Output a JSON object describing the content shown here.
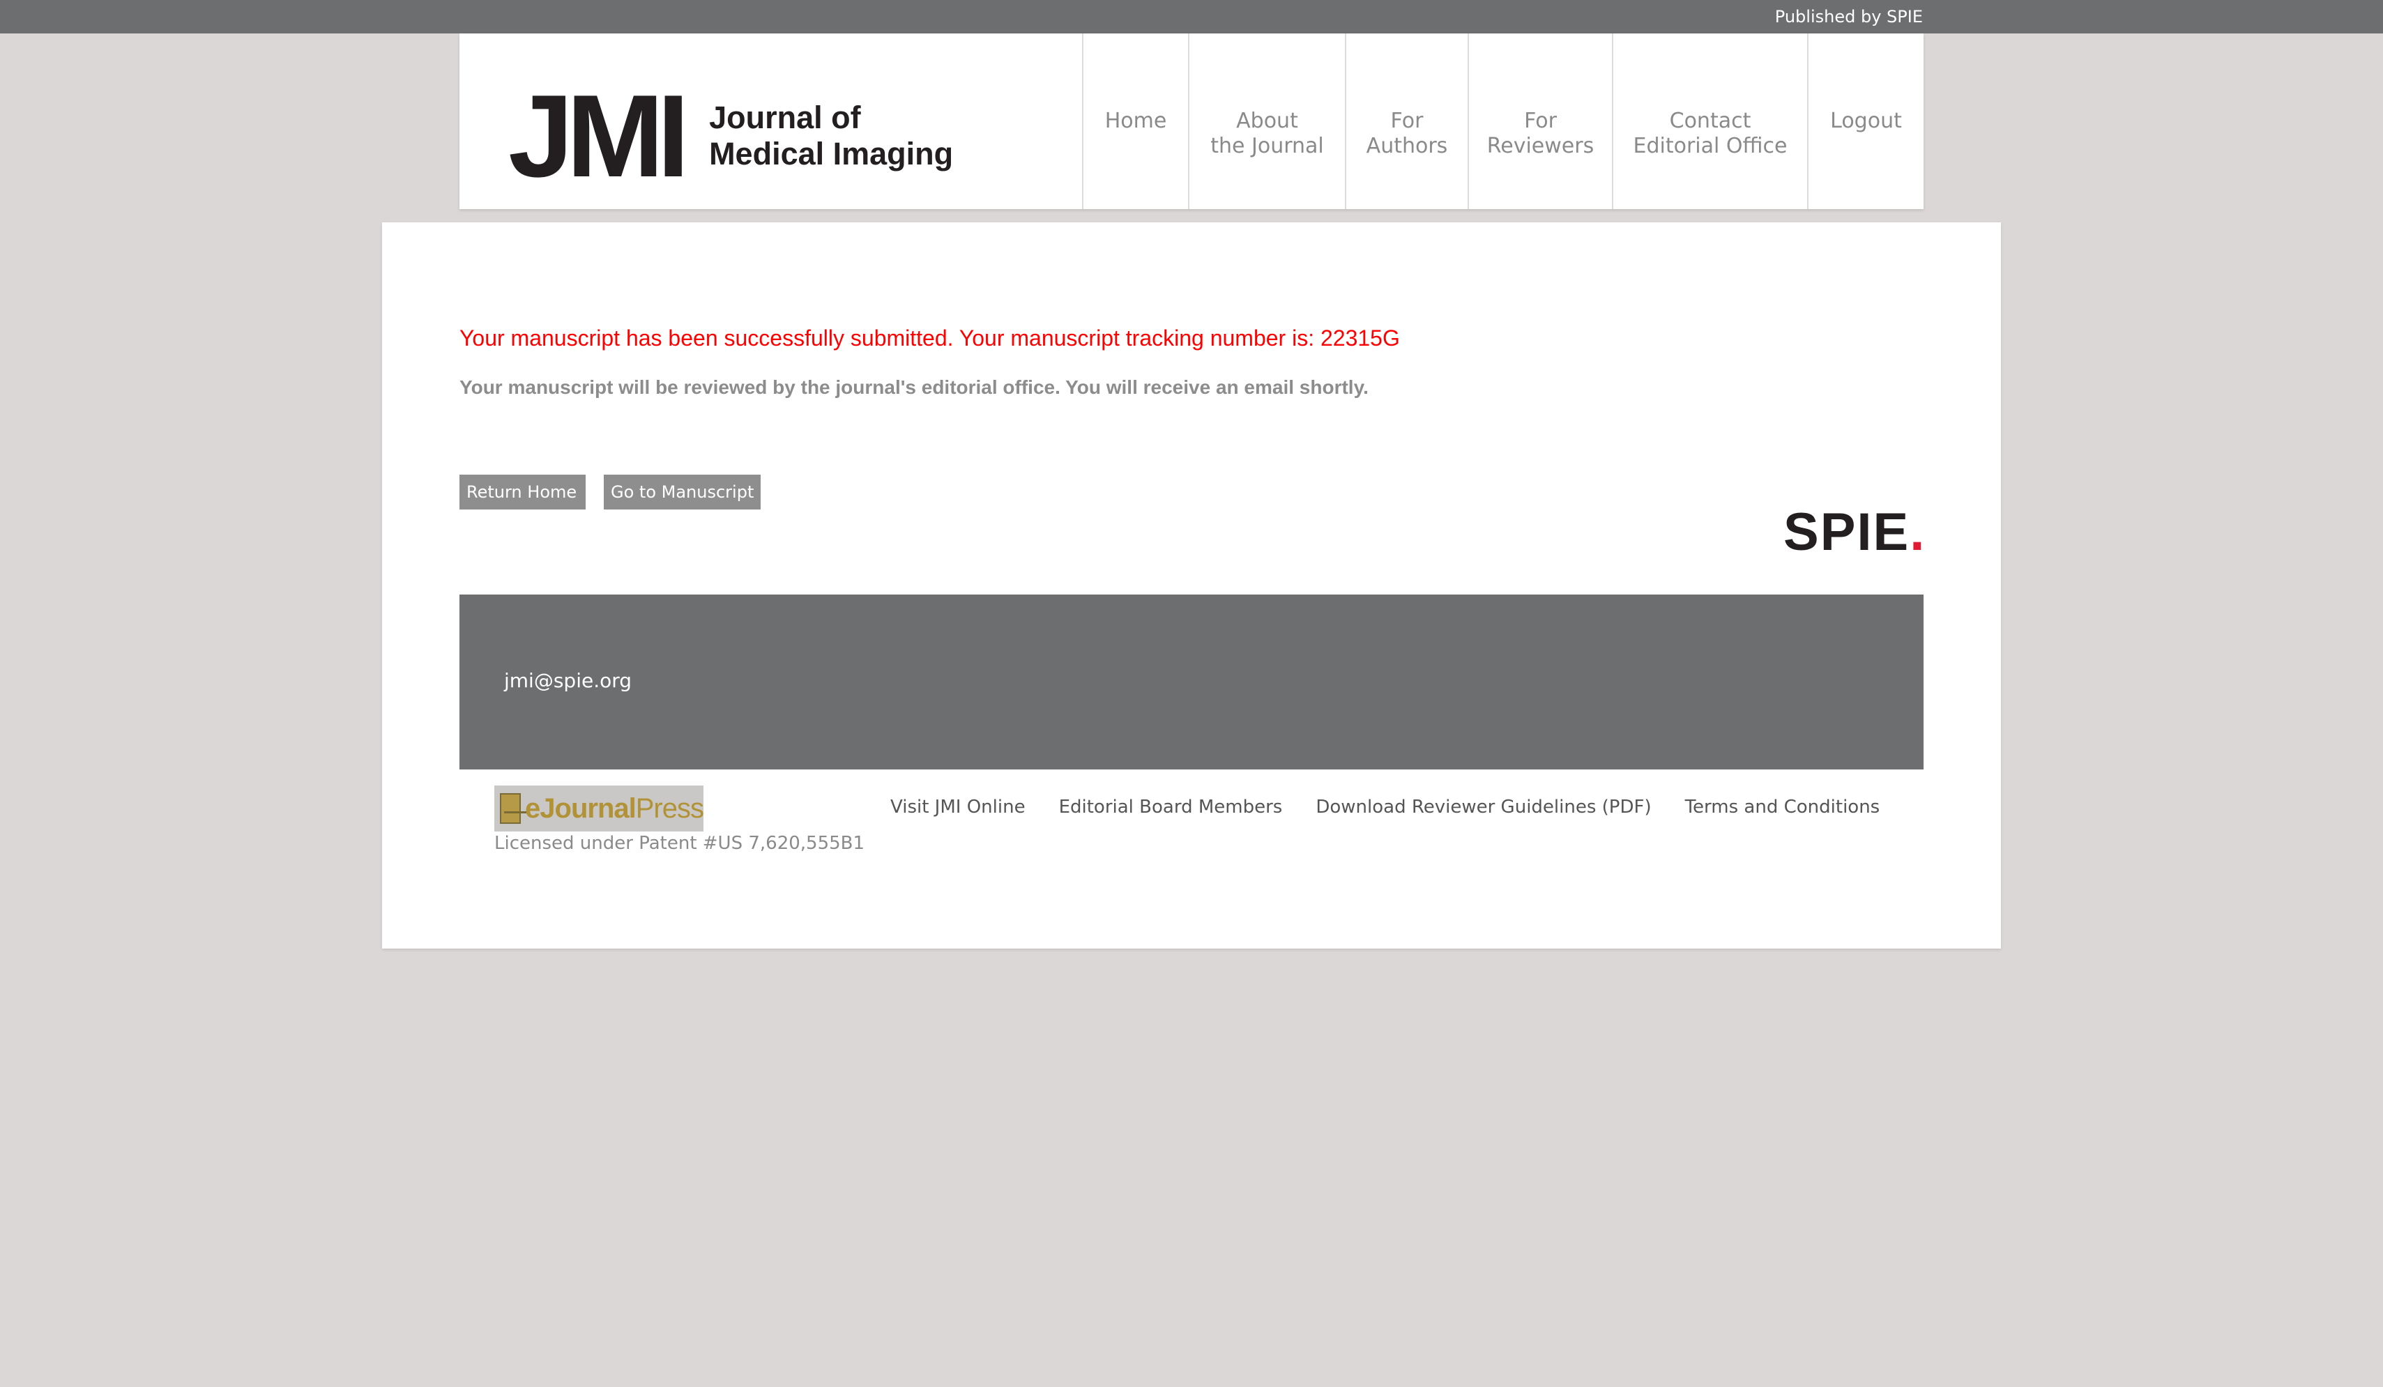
{
  "topbar": {
    "published_by": "Published by SPIE"
  },
  "header": {
    "logo": {
      "abbr": "JMI",
      "name_line1": "Journal of",
      "name_line2": "Medical Imaging"
    },
    "nav": [
      {
        "label": "Home"
      },
      {
        "label": "About\nthe Journal"
      },
      {
        "label": "For\nAuthors"
      },
      {
        "label": "For\nReviewers"
      },
      {
        "label": "Contact\nEditorial Office"
      },
      {
        "label": "Logout"
      }
    ]
  },
  "main": {
    "success_message": "Your manuscript has been successfully submitted. Your manuscript tracking number is: 22315G",
    "note": "Your manuscript will be reviewed by the journal's editorial office. You will receive an email shortly.",
    "buttons": {
      "return_home": "Return Home",
      "go_to_manuscript": "Go to Manuscript"
    },
    "spie_logo": {
      "text": "SPIE",
      "dot": "."
    }
  },
  "contact": {
    "email": "jmi@spie.org"
  },
  "footer": {
    "ejournalpress": {
      "bold_part": "eJournal",
      "regular_part": "Press"
    },
    "patent": "Licensed under Patent #US 7,620,555B1",
    "links": [
      {
        "label": "Visit JMI Online"
      },
      {
        "label": "Editorial Board Members"
      },
      {
        "label": "Download Reviewer Guidelines (PDF)"
      },
      {
        "label": "Terms and Conditions"
      }
    ]
  },
  "colors": {
    "topbar": "#6d6e70",
    "page_background": "#dbd7d6",
    "success_red": "#ff0000",
    "spie_dot_red": "#e21b35",
    "button_gray": "#8e8e8e",
    "ejp_gold": "#b29236"
  }
}
